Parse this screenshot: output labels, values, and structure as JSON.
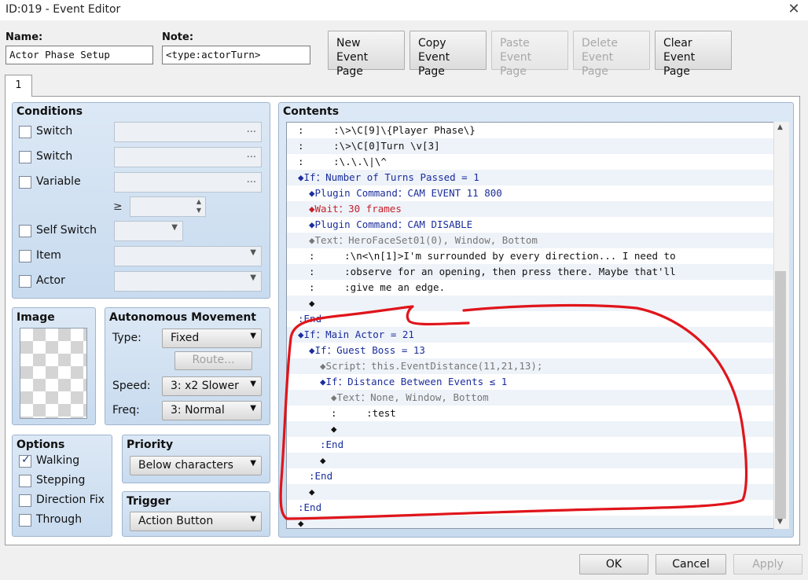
{
  "window": {
    "title": "ID:019 - Event Editor",
    "close_glyph": "✕"
  },
  "name": {
    "label": "Name:",
    "value": "Actor Phase Setup"
  },
  "note": {
    "label": "Note:",
    "value": "<type:actorTurn>"
  },
  "page_buttons": [
    {
      "line1": "New",
      "line2": "Event Page",
      "enabled": true
    },
    {
      "line1": "Copy",
      "line2": "Event Page",
      "enabled": true
    },
    {
      "line1": "Paste",
      "line2": "Event Page",
      "enabled": false
    },
    {
      "line1": "Delete",
      "line2": "Event Page",
      "enabled": false
    },
    {
      "line1": "Clear",
      "line2": "Event Page",
      "enabled": true
    }
  ],
  "tab": {
    "label": "1"
  },
  "conditions": {
    "title": "Conditions",
    "items": [
      {
        "label": "Switch",
        "checked": false
      },
      {
        "label": "Switch",
        "checked": false
      },
      {
        "label": "Variable",
        "checked": false
      },
      {
        "label": "Self Switch",
        "checked": false
      },
      {
        "label": "Item",
        "checked": false
      },
      {
        "label": "Actor",
        "checked": false
      }
    ],
    "gte_symbol": "≥",
    "dots": "..."
  },
  "image": {
    "title": "Image"
  },
  "autonomous": {
    "title": "Autonomous Movement",
    "type_label": "Type:",
    "type_value": "Fixed",
    "route_button": "Route...",
    "speed_label": "Speed:",
    "speed_value": "3: x2 Slower",
    "freq_label": "Freq:",
    "freq_value": "3: Normal"
  },
  "options": {
    "title": "Options",
    "items": [
      {
        "label": "Walking",
        "checked": true
      },
      {
        "label": "Stepping",
        "checked": false
      },
      {
        "label": "Direction Fix",
        "checked": false
      },
      {
        "label": "Through",
        "checked": false
      }
    ]
  },
  "priority": {
    "title": "Priority",
    "value": "Below characters"
  },
  "trigger": {
    "title": "Trigger",
    "value": "Action Button"
  },
  "contents": {
    "title": "Contents",
    "rows": [
      {
        "indent": 0,
        "text": ":     :\\>\\C[9]\\{Player Phase\\}",
        "cls": ""
      },
      {
        "indent": 0,
        "text": ":     :\\>\\C[0]Turn \\v[3]",
        "cls": ""
      },
      {
        "indent": 0,
        "text": ":     :\\.\\.\\|\\^",
        "cls": ""
      },
      {
        "indent": 0,
        "text": "◆If：Number of Turns Passed = 1",
        "cls": "blue"
      },
      {
        "indent": 1,
        "text": "◆Plugin Command：CAM EVENT 11 800",
        "cls": "blue"
      },
      {
        "indent": 1,
        "text": "◆Wait：30 frames",
        "cls": "red"
      },
      {
        "indent": 1,
        "text": "◆Plugin Command：CAM DISABLE",
        "cls": "blue"
      },
      {
        "indent": 1,
        "text": "◆Text：HeroFaceSet01(0), Window, Bottom",
        "cls": "grey"
      },
      {
        "indent": 1,
        "text": ":     :\\n<\\n[1]>I'm surrounded by every direction... I need to",
        "cls": ""
      },
      {
        "indent": 1,
        "text": ":     :observe for an opening, then press there. Maybe that'll",
        "cls": ""
      },
      {
        "indent": 1,
        "text": ":     :give me an edge.",
        "cls": ""
      },
      {
        "indent": 1,
        "text": "◆",
        "cls": ""
      },
      {
        "indent": 0,
        "text": ":End",
        "cls": "blue"
      },
      {
        "indent": 0,
        "text": "◆If：Main Actor = 21",
        "cls": "blue"
      },
      {
        "indent": 1,
        "text": "◆If：Guest Boss = 13",
        "cls": "blue"
      },
      {
        "indent": 2,
        "text": "◆Script：this.EventDistance(11,21,13);",
        "cls": "grey"
      },
      {
        "indent": 2,
        "text": "◆If：Distance Between Events ≤ 1",
        "cls": "blue"
      },
      {
        "indent": 3,
        "text": "◆Text：None, Window, Bottom",
        "cls": "grey"
      },
      {
        "indent": 3,
        "text": ":     :test",
        "cls": ""
      },
      {
        "indent": 3,
        "text": "◆",
        "cls": ""
      },
      {
        "indent": 2,
        "text": ":End",
        "cls": "blue"
      },
      {
        "indent": 2,
        "text": "◆",
        "cls": ""
      },
      {
        "indent": 1,
        "text": ":End",
        "cls": "blue"
      },
      {
        "indent": 1,
        "text": "◆",
        "cls": ""
      },
      {
        "indent": 0,
        "text": ":End",
        "cls": "blue"
      },
      {
        "indent": 0,
        "text": "◆",
        "cls": ""
      }
    ]
  },
  "footer": {
    "ok": "OK",
    "cancel": "Cancel",
    "apply": "Apply"
  },
  "annotation": {
    "color": "#e0151b"
  }
}
